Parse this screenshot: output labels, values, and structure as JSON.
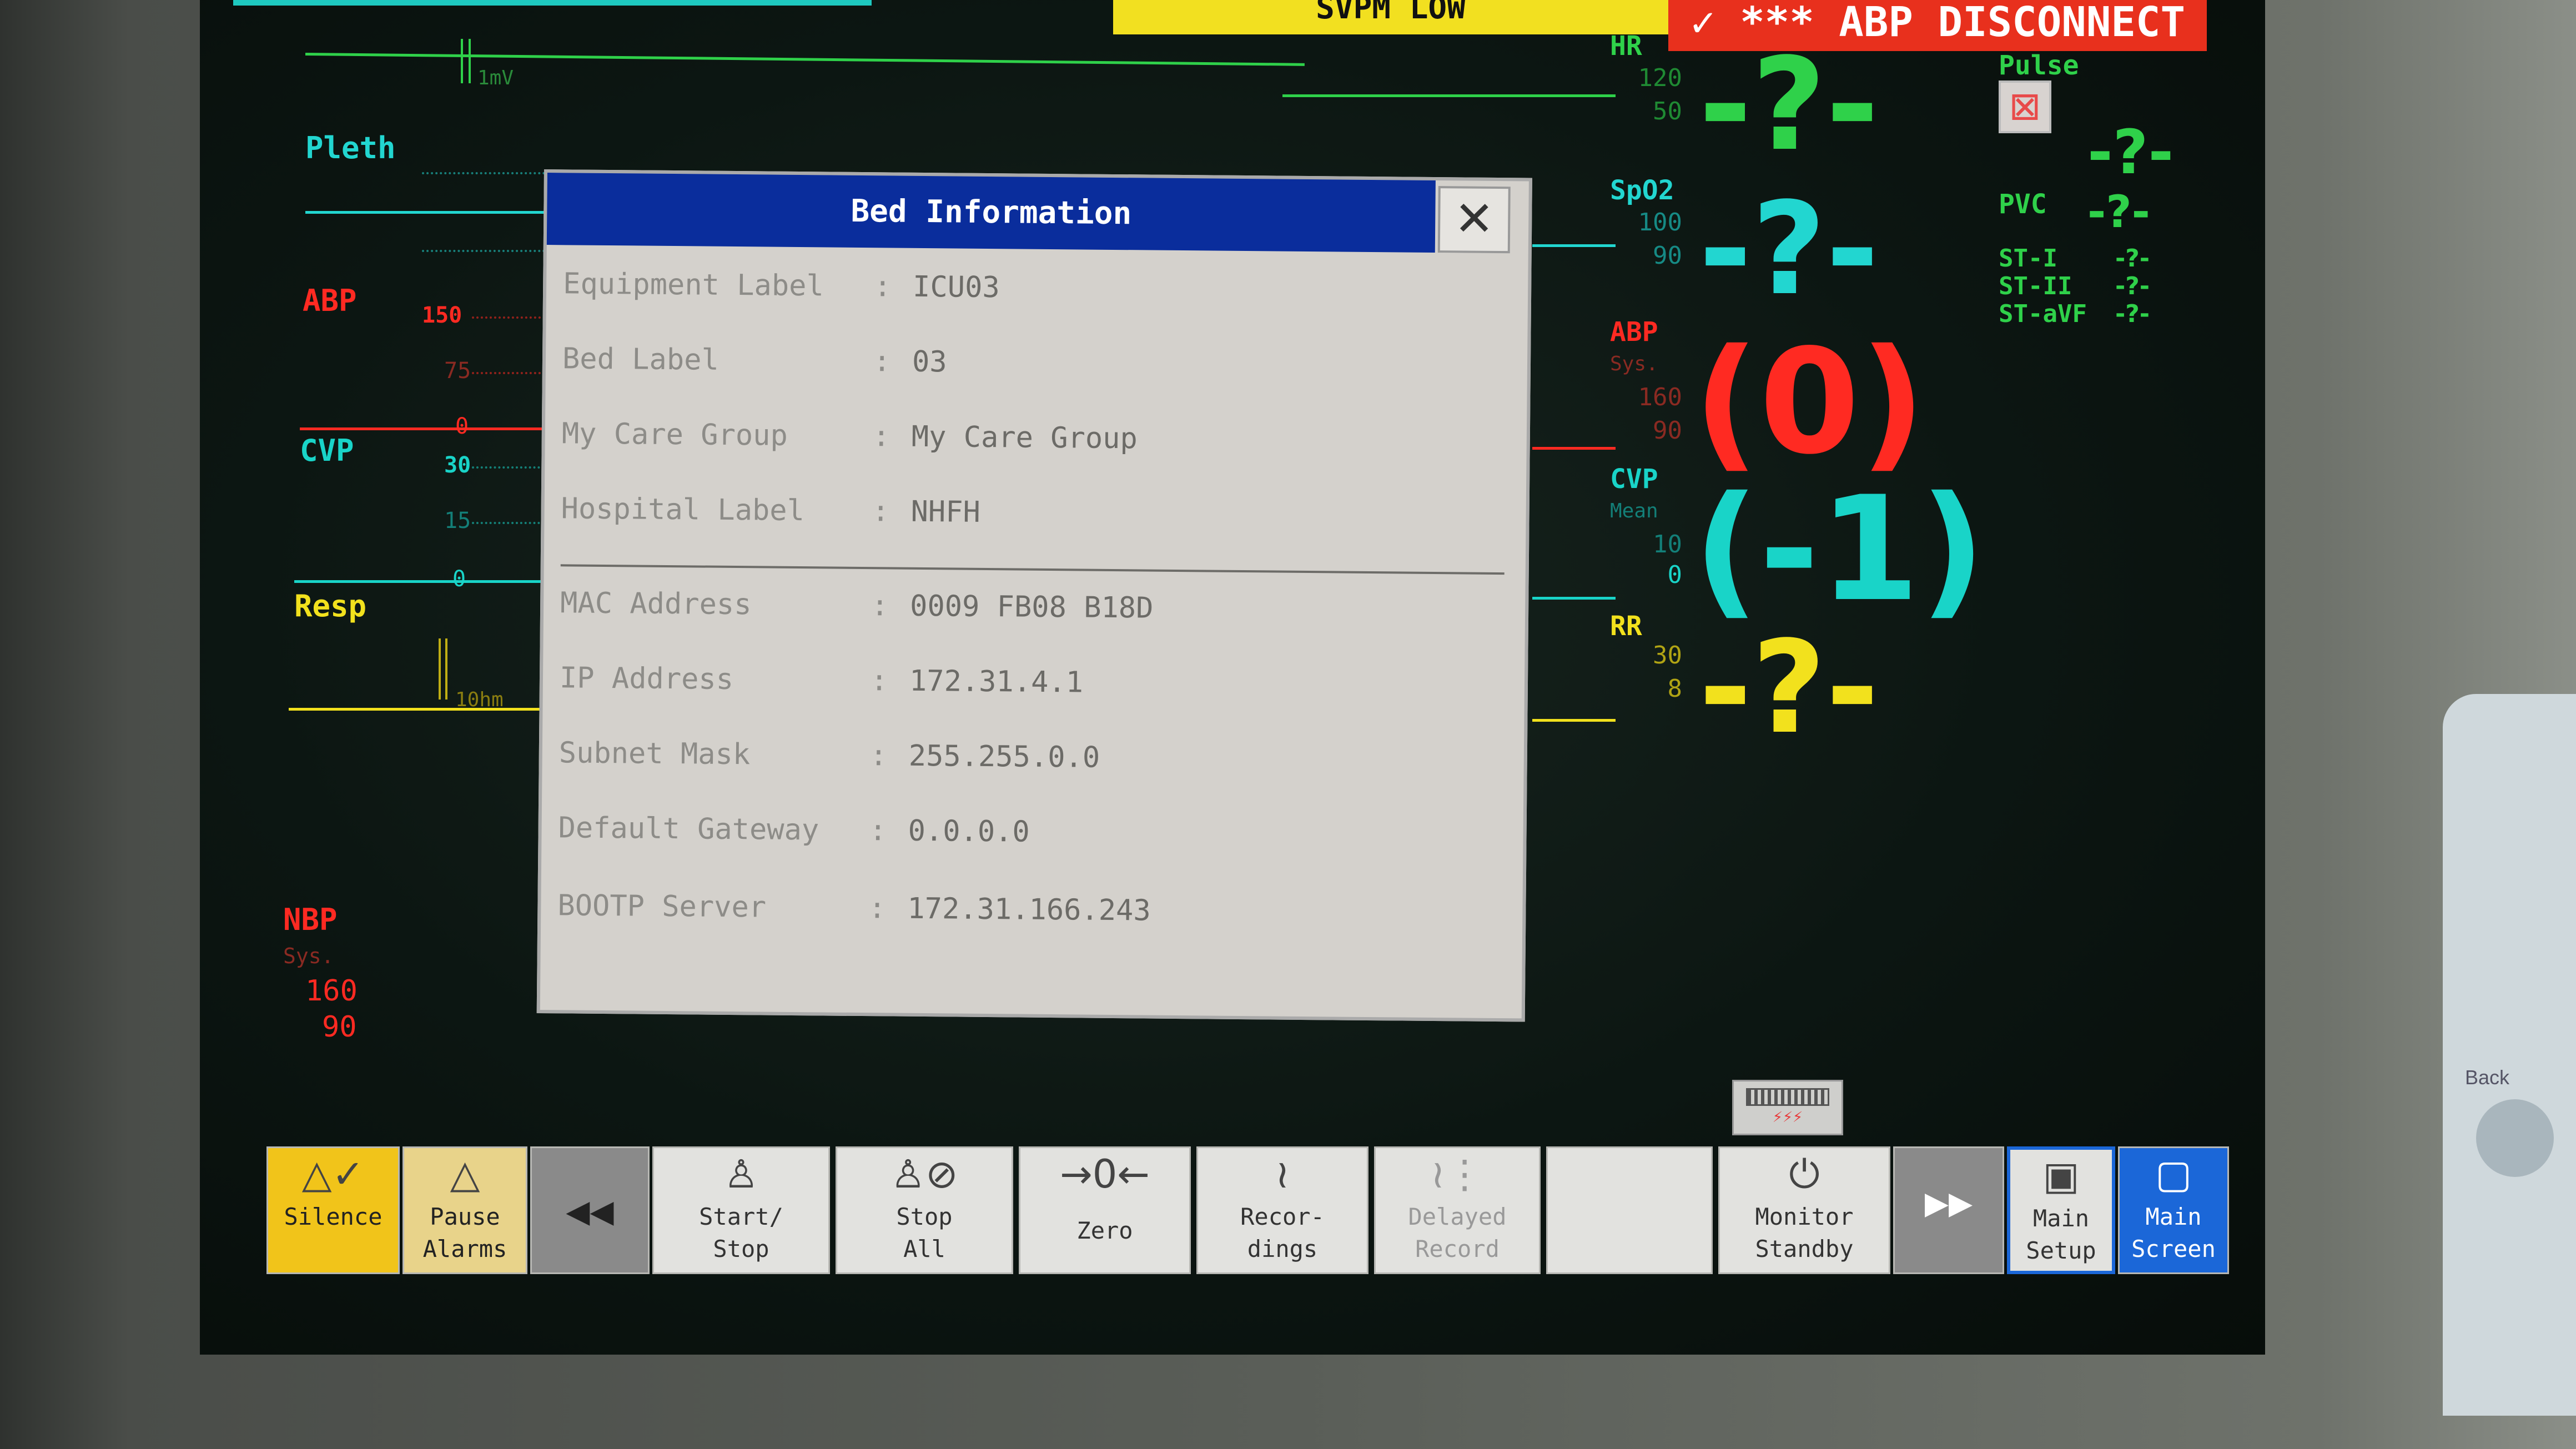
{
  "alarms": {
    "yellow_text": "SVPM  LOW",
    "red_text": "✓ *** ABP DISCONNECT"
  },
  "waveforms": {
    "ecg_mark": "1mV",
    "pleth_label": "Pleth",
    "abp_label": "ABP",
    "abp_scale_top": "150",
    "abp_scale_mid": "75",
    "abp_scale_bot": "0",
    "cvp_label": "CVP",
    "cvp_scale_top": "30",
    "cvp_scale_mid": "15",
    "cvp_scale_bot": "0",
    "resp_label": "Resp",
    "resp_mark": "10hm",
    "nbp_label": "NBP",
    "nbp_sub": "Sys.",
    "nbp_high": "160",
    "nbp_low": "90"
  },
  "params": {
    "hr_label": "HR",
    "hr_high": "120",
    "hr_low": "50",
    "hr_value": "-?-",
    "pulse_label": "Pulse",
    "pulse_value": "-?-",
    "pvc_label": "PVC",
    "pvc_value": "-?-",
    "st1_label": "ST-I",
    "st1_value": "-?-",
    "st2_label": "ST-II",
    "st2_value": "-?-",
    "stavf_label": "ST-aVF",
    "stavf_value": "-?-",
    "spo2_label": "SpO2",
    "spo2_high": "100",
    "spo2_low": "90",
    "spo2_value": "-?-",
    "abp_label": "ABP",
    "abp_sub": "Sys.",
    "abp_high": "160",
    "abp_low": "90",
    "abp_value": "(0)",
    "cvp_label": "CVP",
    "cvp_sub": "Mean",
    "cvp_high": "10",
    "cvp_low": "0",
    "cvp_value": "(-1)",
    "rr_label": "RR",
    "rr_high": "30",
    "rr_low": "8",
    "rr_value": "-?-"
  },
  "colors": {
    "ecg": "#2fd14a",
    "pleth": "#22d6d0",
    "abp": "#ff2a22",
    "cvp": "#19d4c8",
    "resp": "#f2e11d",
    "nbp": "#ff2a22"
  },
  "dialog": {
    "title": "Bed Information",
    "close_glyph": "✕",
    "rows": [
      {
        "key": "Equipment Label",
        "sep": ":",
        "value": "ICU03"
      },
      {
        "key": "Bed Label",
        "sep": ":",
        "value": "03"
      },
      {
        "key": "My Care Group",
        "sep": ":",
        "value": "My Care Group"
      },
      {
        "key": "Hospital Label",
        "sep": ":",
        "value": "NHFH"
      },
      {
        "key": "MAC Address",
        "sep": ":",
        "value": "0009 FB08 B18D"
      },
      {
        "key": "IP Address",
        "sep": ":",
        "value": "172.31.4.1"
      },
      {
        "key": "Subnet Mask",
        "sep": ":",
        "value": "255.255.0.0"
      },
      {
        "key": "Default Gateway",
        "sep": ":",
        "value": "0.0.0.0"
      },
      {
        "key": "BOOTP Server",
        "sep": ":",
        "value": "172.31.166.243"
      }
    ]
  },
  "toolbar": {
    "silence": "Silence",
    "pause_1": "Pause",
    "pause_2": "Alarms",
    "prev_glyph": "◀◀",
    "start_1": "Start/",
    "start_2": "Stop",
    "stop_1": "Stop",
    "stop_2": "All",
    "zero": "Zero",
    "rec_1": "Recor-",
    "rec_2": "dings",
    "delayed_1": "Delayed",
    "delayed_2": "Record",
    "standby_1": "Monitor",
    "standby_2": "Standby",
    "next_glyph": "▶▶",
    "main_setup_1": "Main",
    "main_setup_2": "Setup",
    "main_screen_1": "Main",
    "main_screen_2": "Screen"
  },
  "side_panel": {
    "back_label": "Back"
  }
}
